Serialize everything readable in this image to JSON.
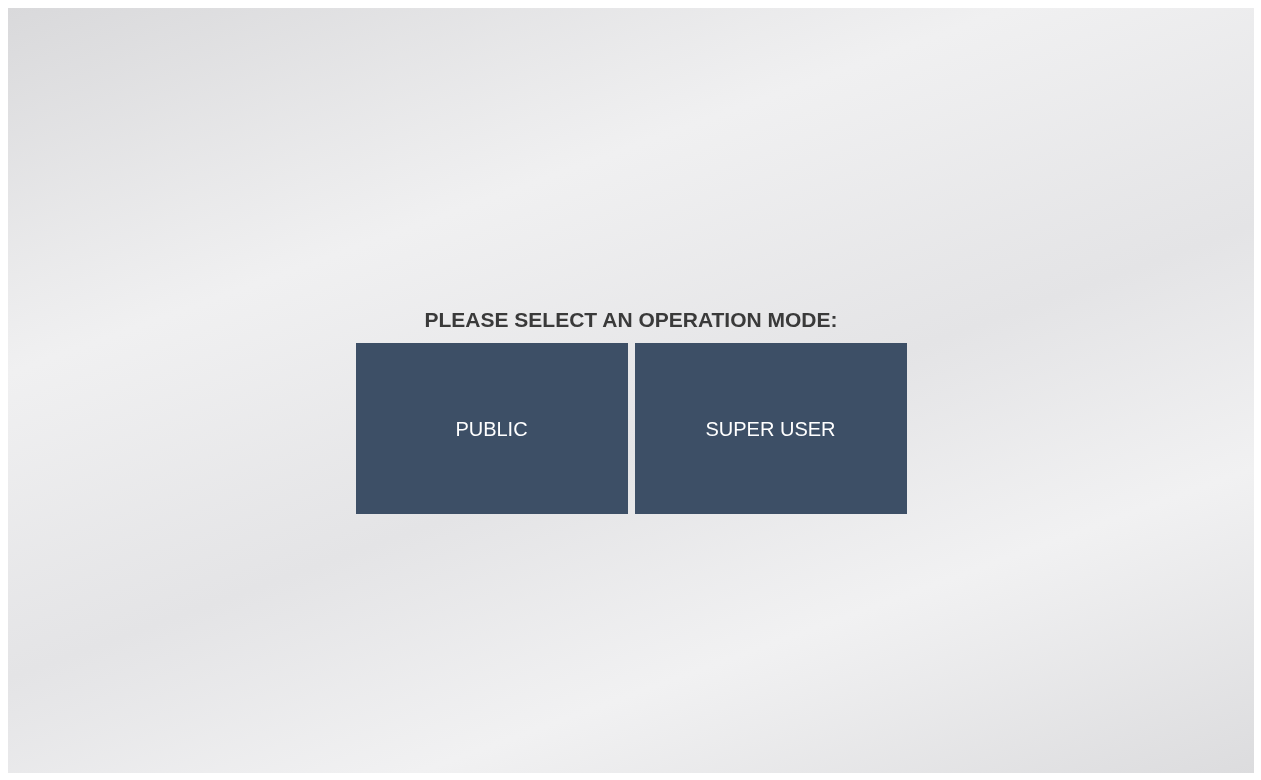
{
  "prompt": "PLEASE SELECT AN OPERATION MODE:",
  "modes": [
    {
      "label": "PUBLIC"
    },
    {
      "label": "SUPER USER"
    }
  ]
}
